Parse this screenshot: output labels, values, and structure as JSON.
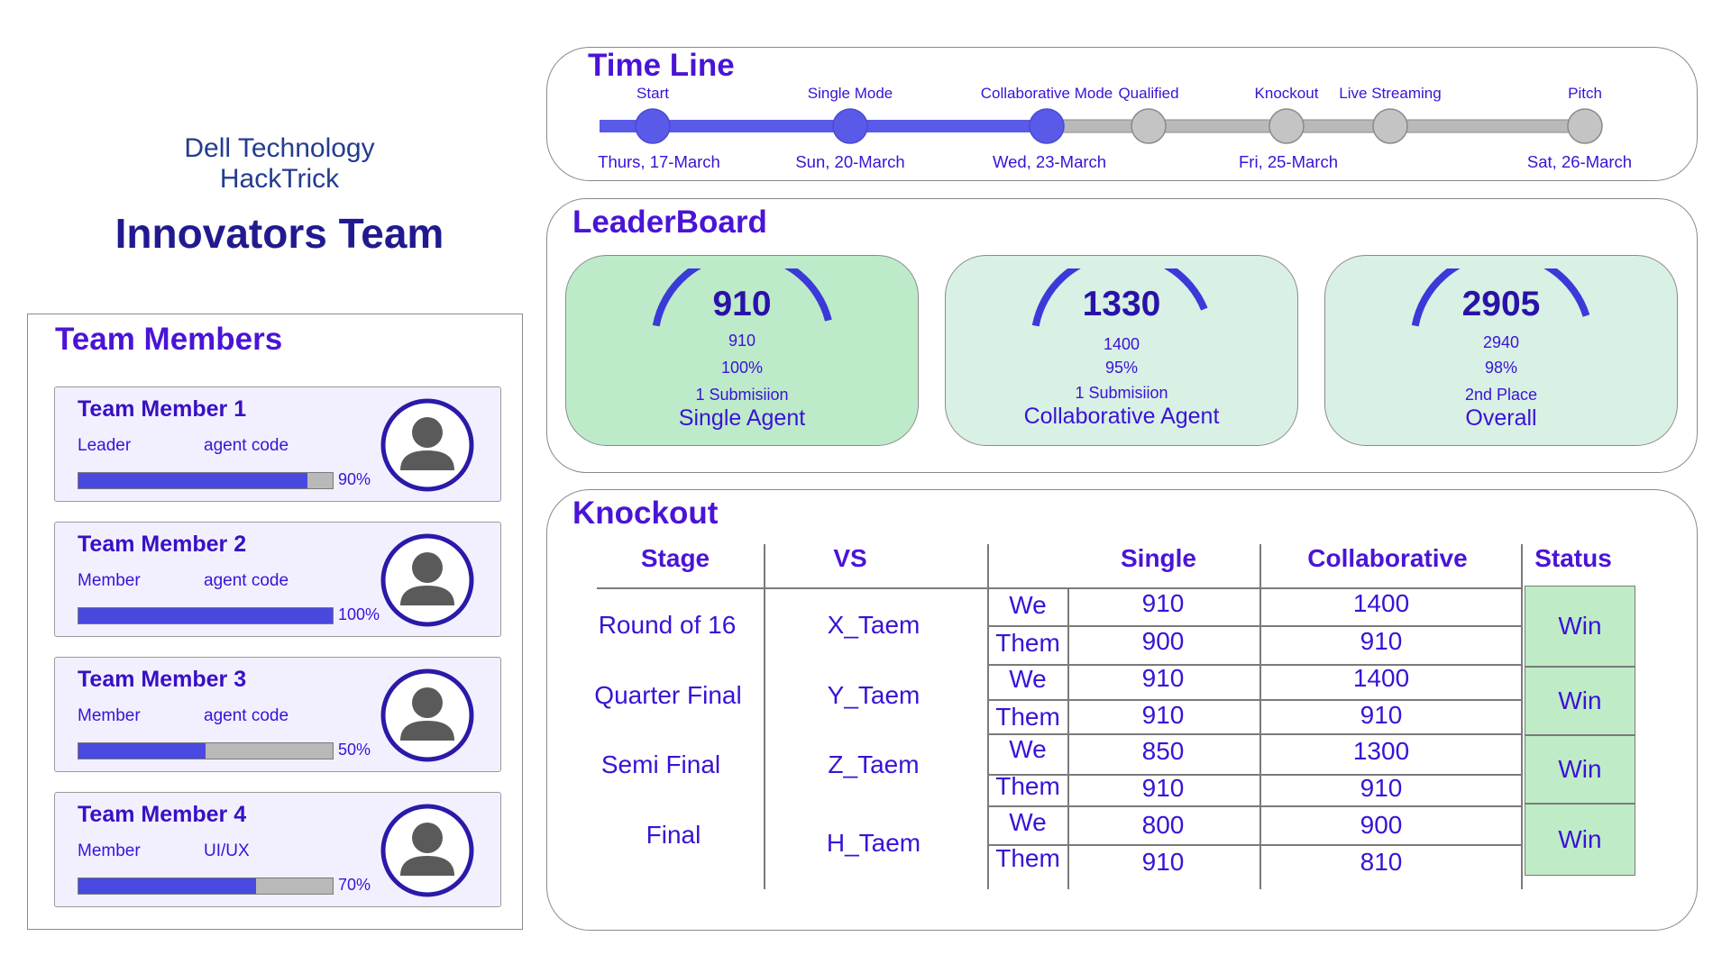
{
  "brand": {
    "line1": "Dell Technology",
    "line2": "HackTrick",
    "team": "Innovators Team"
  },
  "members": {
    "title": "Team Members",
    "items": [
      {
        "name": "Team Member 1",
        "role": "Leader",
        "skill": "agent code",
        "progress": 90,
        "progress_label": "90%"
      },
      {
        "name": "Team Member 2",
        "role": "Member",
        "skill": "agent code",
        "progress": 100,
        "progress_label": "100%"
      },
      {
        "name": "Team Member 3",
        "role": "Member",
        "skill": "agent code",
        "progress": 50,
        "progress_label": "50%"
      },
      {
        "name": "Team Member 4",
        "role": "Member",
        "skill": "UI/UX",
        "progress": 70,
        "progress_label": "70%"
      }
    ]
  },
  "timeline": {
    "title": "Time Line",
    "milestones": [
      {
        "label": "Start",
        "done": true
      },
      {
        "label": "Single Mode",
        "done": true
      },
      {
        "label": "Collaborative Mode",
        "done": true
      },
      {
        "label": "Qualified",
        "done": false
      },
      {
        "label": "Knockout",
        "done": false
      },
      {
        "label": "Live Streaming",
        "done": false
      },
      {
        "label": "Pitch",
        "done": false
      }
    ],
    "dates": [
      "Thurs, 17-March",
      "Sun, 20-March",
      "Wed, 23-March",
      "Fri, 25-March",
      "Sat, 26-March"
    ],
    "colors": {
      "done": "#5a5ae8",
      "pending": "#b9b9b9"
    }
  },
  "leaderboard": {
    "title": "LeaderBoard",
    "cards": [
      {
        "score": "910",
        "line1": "910",
        "line2": "100%",
        "line3": "1 Submisiion",
        "caption": "Single Agent",
        "color": "#bdebc9",
        "gauge": 1.0
      },
      {
        "score": "1330",
        "line1": "1400",
        "line2": "95%",
        "line3": "1 Submisiion",
        "caption": "Collaborative Agent",
        "color": "#d8f1e4",
        "gauge": 0.95
      },
      {
        "score": "2905",
        "line1": "2940",
        "line2": "98%",
        "line3": "2nd Place",
        "caption": "Overall",
        "color": "#d8f1e4",
        "gauge": 0.98
      }
    ]
  },
  "knockout": {
    "title": "Knockout",
    "headers": {
      "stage": "Stage",
      "vs": "VS",
      "single": "Single",
      "collab": "Collaborative",
      "status": "Status"
    },
    "rows": [
      {
        "stage": "Round of 16",
        "vs": "X_Taem",
        "we_label": "We",
        "them_label": "Them",
        "we_single": "910",
        "them_single": "900",
        "we_collab": "1400",
        "them_collab": "910",
        "status": "Win"
      },
      {
        "stage": "Quarter Final",
        "vs": "Y_Taem",
        "we_label": "We",
        "them_label": "Them",
        "we_single": "910",
        "them_single": "910",
        "we_collab": "1400",
        "them_collab": "910",
        "status": "Win"
      },
      {
        "stage": "Semi Final",
        "vs": "Z_Taem",
        "we_label": "We",
        "them_label": "Them",
        "we_single": "850",
        "them_single": "910",
        "we_collab": "1300",
        "them_collab": "910",
        "status": "Win"
      },
      {
        "stage": "Final",
        "vs": "H_Taem",
        "we_label": "We",
        "them_label": "Them",
        "we_single": "800",
        "them_single": "910",
        "we_collab": "900",
        "them_collab": "810",
        "status": "Win"
      }
    ],
    "status_color": "#bfecc6"
  }
}
